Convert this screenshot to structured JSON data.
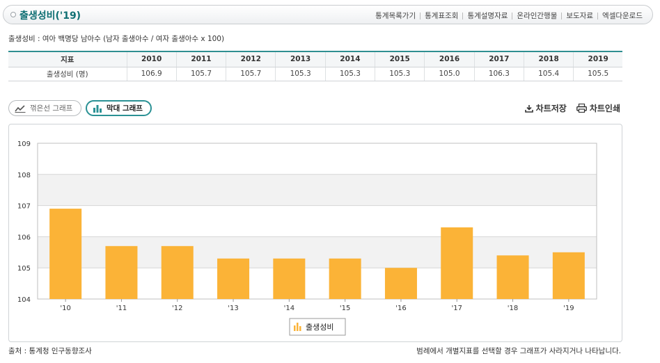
{
  "header": {
    "title": "출생성비('19)",
    "links": [
      "통계목록가기",
      "통계표조회",
      "통계설명자료",
      "온라인간행물",
      "보도자료",
      "엑셀다운로드"
    ]
  },
  "formula": "출생성비 : 여아 백명당 남아수 (남자 출생아수 / 여자 출생아수 x 100)",
  "table": {
    "header_label": "지표",
    "years": [
      "2010",
      "2011",
      "2012",
      "2013",
      "2014",
      "2015",
      "2016",
      "2017",
      "2018",
      "2019"
    ],
    "row_label": "출생성비 (명)",
    "values": [
      "106.9",
      "105.7",
      "105.7",
      "105.3",
      "105.3",
      "105.3",
      "105.0",
      "106.3",
      "105.4",
      "105.5"
    ]
  },
  "buttons": {
    "line_graph": "꺾은선 그래프",
    "bar_graph": "막대 그래프",
    "save_chart": "차트저장",
    "print_chart": "차트인쇄"
  },
  "colors": {
    "bar": "#FBB337",
    "accent": "#2A9194",
    "title": "#0F6F73"
  },
  "chart_data": {
    "type": "bar",
    "categories": [
      "'10",
      "'11",
      "'12",
      "'13",
      "'14",
      "'15",
      "'16",
      "'17",
      "'18",
      "'19"
    ],
    "series": [
      {
        "name": "출생성비",
        "values": [
          106.9,
          105.7,
          105.7,
          105.3,
          105.3,
          105.3,
          105.0,
          106.3,
          105.4,
          105.5
        ]
      }
    ],
    "ylim": [
      104,
      109
    ],
    "yticks": [
      "104",
      "105",
      "106",
      "107",
      "108",
      "109"
    ],
    "legend": "bottom-center",
    "grid": true
  },
  "footer": {
    "source": "출처 : 통계청 인구동향조사",
    "note": "범례에서 개별지표를 선택할 경우 그래프가 사라지거나 나타납니다."
  }
}
